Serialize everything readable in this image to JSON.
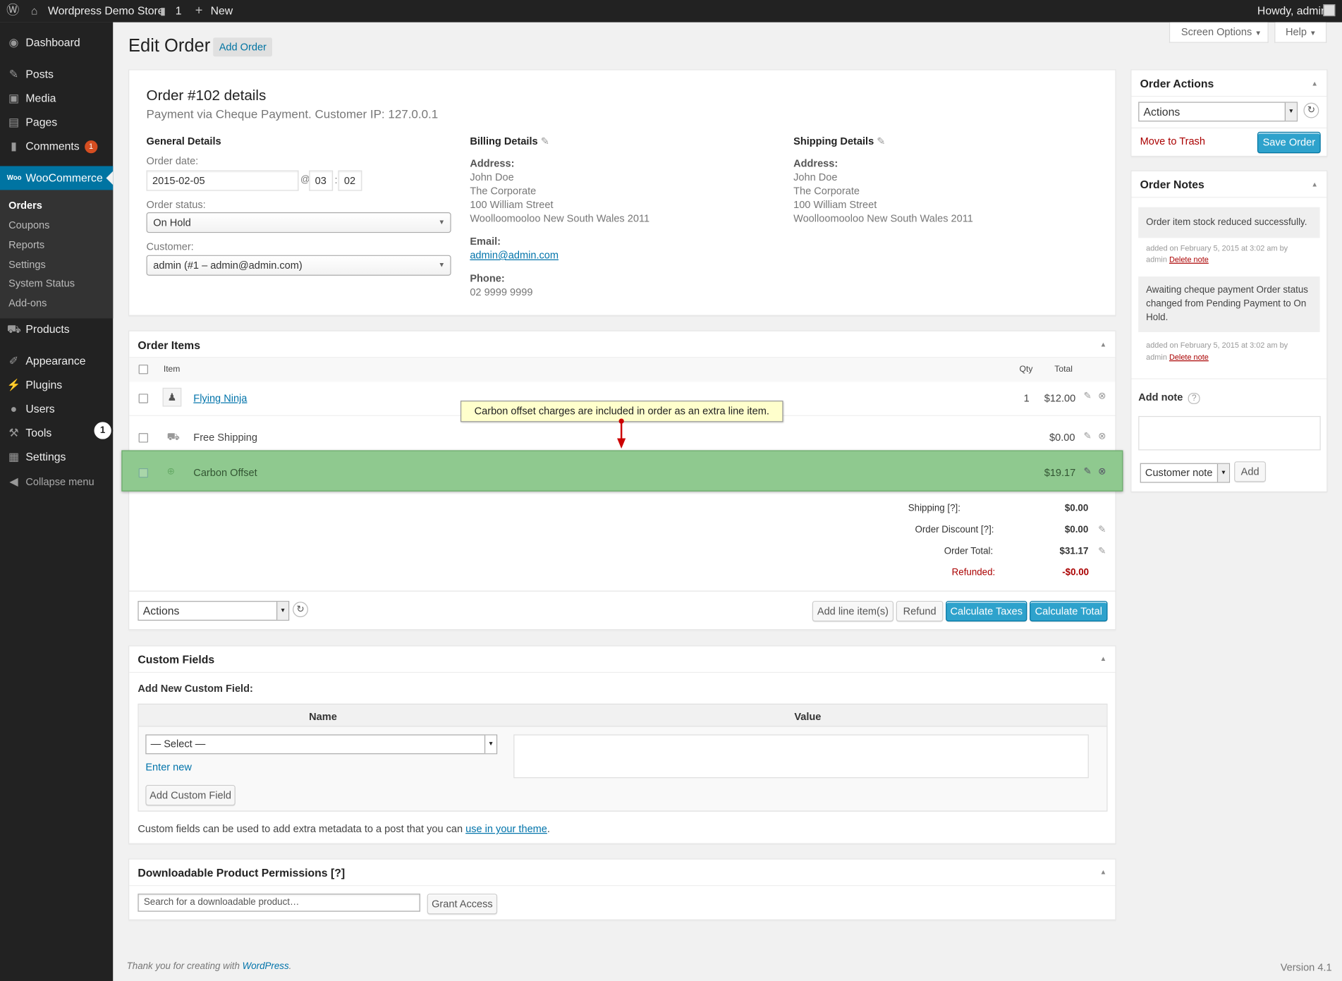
{
  "admin_bar": {
    "site_name": "Wordpress Demo Store",
    "comments_count": "1",
    "new_label": "New",
    "howdy": "Howdy, admin"
  },
  "sidebar": {
    "dashboard": "Dashboard",
    "posts": "Posts",
    "media": "Media",
    "pages": "Pages",
    "comments": "Comments",
    "comments_badge": "1",
    "woocommerce": "WooCommerce",
    "woo_sub": [
      "Orders",
      "Coupons",
      "Reports",
      "Settings",
      "System Status",
      "Add-ons"
    ],
    "products": "Products",
    "appearance": "Appearance",
    "plugins": "Plugins",
    "users": "Users",
    "tools": "Tools",
    "settings": "Settings",
    "collapse": "Collapse menu",
    "step_marker": "1"
  },
  "header": {
    "title": "Edit Order",
    "add_order": "Add Order",
    "screen_options": "Screen Options",
    "help": "Help"
  },
  "order": {
    "title": "Order #102 details",
    "subtitle": "Payment via Cheque Payment. Customer IP: 127.0.0.1",
    "general_heading": "General Details",
    "date_label": "Order date:",
    "date_value": "2015-02-05",
    "at": "@",
    "hour": "03",
    "colon": ":",
    "minute": "02",
    "status_label": "Order status:",
    "status_value": "On Hold",
    "customer_label": "Customer:",
    "customer_value": "admin (#1 – admin@admin.com)",
    "billing_heading": "Billing Details",
    "billing_address_label": "Address:",
    "billing_address": [
      "John Doe",
      "The Corporate",
      "100 William Street",
      "Woolloomooloo New South Wales 2011"
    ],
    "email_label": "Email:",
    "email": "admin@admin.com",
    "phone_label": "Phone:",
    "phone": "02 9999 9999",
    "shipping_heading": "Shipping Details",
    "shipping_address_label": "Address:",
    "shipping_address": [
      "John Doe",
      "The Corporate",
      "100 William Street",
      "Woolloomooloo New South Wales 2011"
    ]
  },
  "items": {
    "heading": "Order Items",
    "col_item": "Item",
    "col_qty": "Qty",
    "col_total": "Total",
    "rows": [
      {
        "name": "Flying Ninja",
        "qty": "1",
        "total": "$12.00"
      },
      {
        "name": "Free Shipping",
        "qty": "",
        "total": "$0.00"
      },
      {
        "name": "Carbon Offset",
        "qty": "",
        "total": "$19.17"
      }
    ],
    "callout": "Carbon offset charges are included in order as an extra line item.",
    "totals": [
      {
        "label": "Shipping [?]:",
        "value": "$0.00"
      },
      {
        "label": "Order Discount [?]:",
        "value": "$0.00"
      },
      {
        "label": "Order Total:",
        "value": "$31.17"
      },
      {
        "label": "Refunded:",
        "value": "-$0.00"
      }
    ],
    "actions_value": "Actions",
    "add_line": "Add line item(s)",
    "refund": "Refund",
    "calc_taxes": "Calculate Taxes",
    "calc_total": "Calculate Total"
  },
  "custom_fields": {
    "heading": "Custom Fields",
    "add_new": "Add New Custom Field:",
    "col_name": "Name",
    "col_value": "Value",
    "select_value": "— Select —",
    "enter_new": "Enter new",
    "add_button": "Add Custom Field",
    "note_prefix": "Custom fields can be used to add extra metadata to a post that you can ",
    "note_link": "use in your theme",
    "note_suffix": "."
  },
  "downloads": {
    "heading": "Downloadable Product Permissions [?]",
    "search_placeholder": "Search for a downloadable product…",
    "grant": "Grant Access"
  },
  "order_actions": {
    "heading": "Order Actions",
    "actions_value": "Actions",
    "trash": "Move to Trash",
    "save": "Save Order"
  },
  "order_notes": {
    "heading": "Order Notes",
    "notes": [
      {
        "text": "Order item stock reduced successfully.",
        "meta1": "added on February 5, 2015 at 3:02 am by",
        "meta2": "admin",
        "delete": "Delete note"
      },
      {
        "text": "Awaiting cheque payment Order status changed from Pending Payment to On Hold.",
        "meta1": "added on February 5, 2015 at 3:02 am by",
        "meta2": "admin",
        "delete": "Delete note"
      }
    ],
    "add_note_label": "Add note",
    "note_type": "Customer note",
    "add_button": "Add"
  },
  "footer": {
    "thanks_prefix": "Thank you for creating with ",
    "thanks_link": "WordPress",
    "thanks_suffix": ".",
    "version": "Version 4.1"
  },
  "colors": {
    "accent": "#0073aa",
    "primary_button": "#2ea2cc",
    "highlight_row": "#8fc98f",
    "callout_bg": "#ffffcc",
    "danger": "#a00",
    "sidebar": "#222222"
  }
}
